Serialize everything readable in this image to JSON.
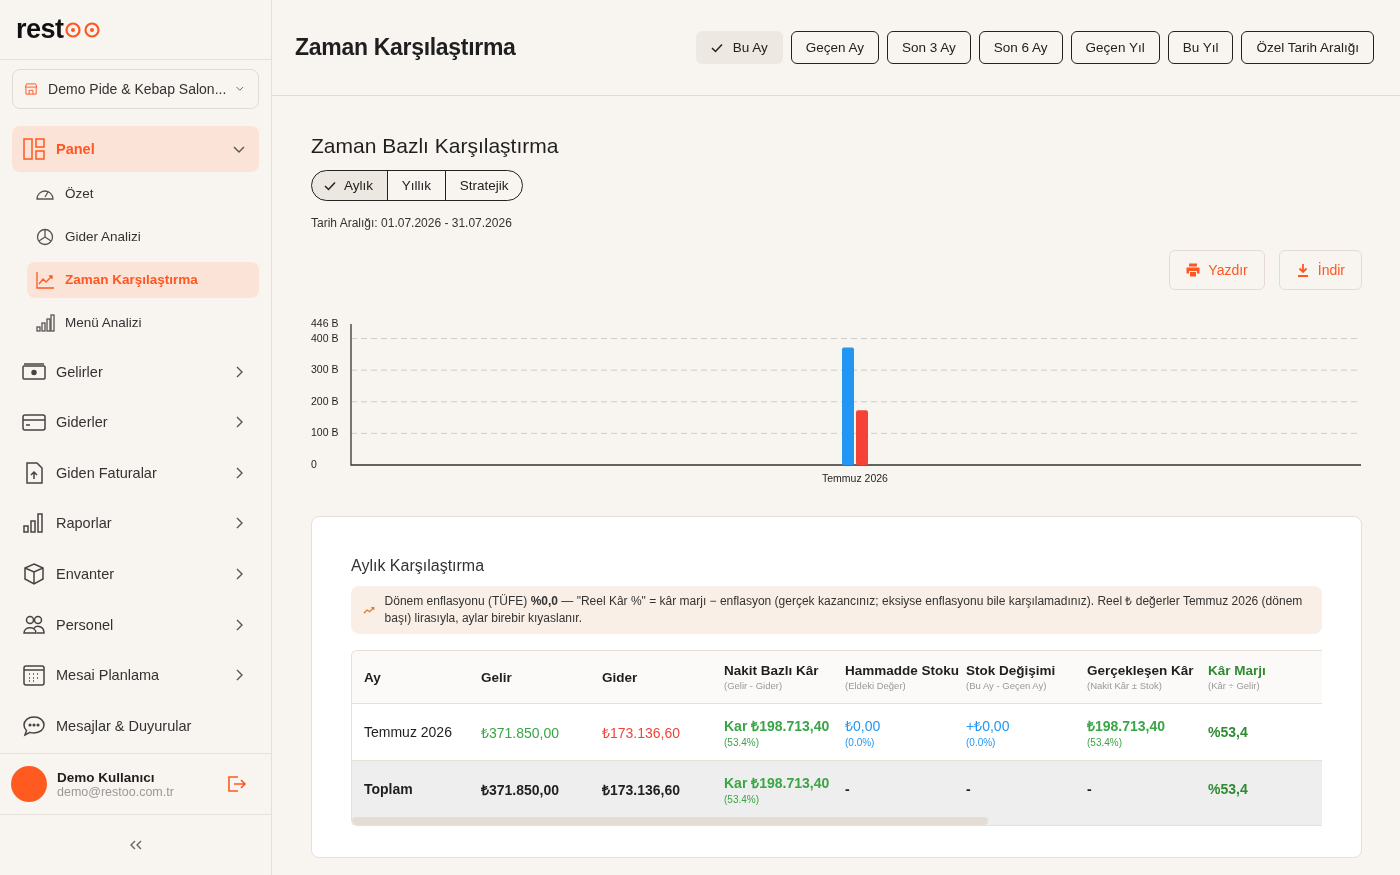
{
  "sidebar": {
    "logo": "rest",
    "branch": {
      "label": "Demo Pide & Kebap Salon..."
    },
    "items": [
      {
        "label": "Panel",
        "kind": "group",
        "expanded": true,
        "children": [
          {
            "label": "Özet",
            "selected": false
          },
          {
            "label": "Gider Analizi",
            "selected": false
          },
          {
            "label": "Zaman Karşılaştırma",
            "selected": true
          },
          {
            "label": "Menü Analizi",
            "selected": false
          }
        ]
      },
      {
        "label": "Gelirler",
        "kind": "group",
        "expanded": false
      },
      {
        "label": "Giderler",
        "kind": "group",
        "expanded": false
      },
      {
        "label": "Giden Faturalar",
        "kind": "group",
        "expanded": false
      },
      {
        "label": "Raporlar",
        "kind": "group",
        "expanded": false
      },
      {
        "label": "Envanter",
        "kind": "group",
        "expanded": false
      },
      {
        "label": "Personel",
        "kind": "group",
        "expanded": false
      },
      {
        "label": "Mesai Planlama",
        "kind": "group",
        "expanded": false
      },
      {
        "label": "Mesajlar & Duyurular",
        "kind": "link"
      }
    ],
    "user": {
      "name": "Demo Kullanıcı",
      "email": "demo@restoo.com.tr"
    }
  },
  "header": {
    "title": "Zaman Karşılaştırma",
    "ranges": [
      {
        "label": "Bu Ay",
        "selected": true
      },
      {
        "label": "Geçen Ay",
        "selected": false
      },
      {
        "label": "Son 3 Ay",
        "selected": false
      },
      {
        "label": "Son 6 Ay",
        "selected": false
      },
      {
        "label": "Geçen Yıl",
        "selected": false
      },
      {
        "label": "Bu Yıl",
        "selected": false
      },
      {
        "label": "Özel Tarih Aralığı",
        "selected": false
      }
    ]
  },
  "section": {
    "title": "Zaman Bazlı Karşılaştırma",
    "modes": [
      {
        "label": "Aylık",
        "selected": true
      },
      {
        "label": "Yıllık",
        "selected": false
      },
      {
        "label": "Stratejik",
        "selected": false
      }
    ],
    "date_range": "Tarih Aralığı: 01.07.2026 - 31.07.2026",
    "actions": [
      {
        "label": "Yazdır",
        "kind": "print"
      },
      {
        "label": "İndir",
        "kind": "download"
      }
    ],
    "chart_data": {
      "type": "bar",
      "grid": true,
      "categories": [
        "Temmuz 2026"
      ],
      "ylim": [
        0,
        446
      ],
      "yticks": [
        {
          "value": 0,
          "label": "0"
        },
        {
          "value": 100,
          "label": "100 B"
        },
        {
          "value": 200,
          "label": "200 B"
        },
        {
          "value": 300,
          "label": "300 B"
        },
        {
          "value": 400,
          "label": "400 B"
        },
        {
          "value": 446,
          "label": "446 B"
        }
      ],
      "series": [
        {
          "color": "#2196f3",
          "values": [
            372
          ]
        },
        {
          "color": "#f44336",
          "values": [
            173
          ]
        }
      ]
    }
  },
  "comparison": {
    "title": "Aylık Karşılaştırma",
    "note": "Dönem enflasyonu (TÜFE) **%0,0** — \"Reel Kâr %\" = kâr marjı − enflasyon (gerçek kazancınız; eksiyse enflasyonu bile karşılamadınız). Reel ₺ değerler Temmuz 2026 (dönem başı) lirasıyla, aylar birebir kıyaslanır.",
    "columns": [
      {
        "label": "Ay",
        "kind": "plain"
      },
      {
        "label": "Gelir",
        "kind": "plain"
      },
      {
        "label": "Gider",
        "kind": "plain"
      },
      {
        "label": "Nakit Bazlı Kâr",
        "sub": "(Gelir - Gider)",
        "kind": "plain"
      },
      {
        "label": "Hammadde Stoku",
        "sub": "(Eldeki Değer)",
        "kind": "plain"
      },
      {
        "label": "Stok Değişimi",
        "sub": "(Bu Ay - Geçen Ay)",
        "kind": "plain"
      },
      {
        "label": "Gerçekleşen Kâr",
        "sub": "(Nakit Kâr ± Stok)",
        "kind": "plain"
      },
      {
        "label": "Kâr Marjı",
        "sub": "(Kâr ÷ Gelir)",
        "kind": "margin"
      }
    ],
    "rows": [
      {
        "kind": "month",
        "cells": [
          {
            "text": "Temmuz 2026",
            "kind": "plain"
          },
          {
            "text": "₺371.850,00",
            "kind": "income"
          },
          {
            "text": "₺173.136,60",
            "kind": "expense"
          },
          {
            "text": "Kar ₺198.713,40",
            "sub": "(53.4%)",
            "kind": "profit"
          },
          {
            "text": "₺0,00",
            "sub": "(0.0%)",
            "kind": "stock"
          },
          {
            "text": "+₺0,00",
            "sub": "(0.0%)",
            "kind": "stock"
          },
          {
            "text": "₺198.713,40",
            "sub": "(53.4%)",
            "kind": "profit"
          },
          {
            "text": "%53,4",
            "kind": "margin"
          }
        ]
      },
      {
        "kind": "total",
        "cells": [
          {
            "text": "Toplam",
            "kind": "plain"
          },
          {
            "text": "₺371.850,00",
            "kind": "plain"
          },
          {
            "text": "₺173.136,60",
            "kind": "plain"
          },
          {
            "text": "Kar ₺198.713,40",
            "sub": "(53.4%)",
            "kind": "profit"
          },
          {
            "text": "-",
            "kind": "plain"
          },
          {
            "text": "-",
            "kind": "plain"
          },
          {
            "text": "-",
            "kind": "plain"
          },
          {
            "text": "%53,4",
            "kind": "margin"
          }
        ]
      }
    ]
  }
}
